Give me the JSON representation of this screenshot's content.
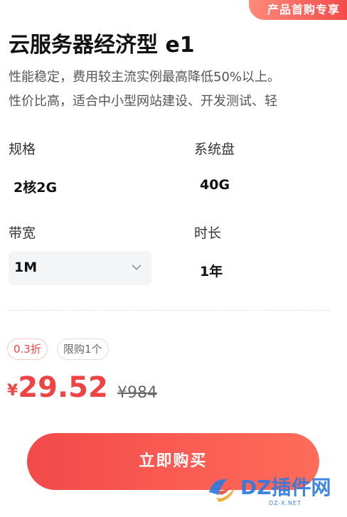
{
  "header": {
    "corner_tag": "产品首购专享",
    "title": "云服务器经济型 e1",
    "desc_lines": [
      "性能稳定，费用较主流实例最高降低50%以上。",
      "性价比高，适合中小型网站建设、开发测试、轻"
    ]
  },
  "specs": {
    "spec_label": "规格",
    "spec_value": "2核2G",
    "disk_label": "系统盘",
    "disk_value": "40G",
    "bandwidth_label": "带宽",
    "bandwidth_value": "1M",
    "duration_label": "时长",
    "duration_value": "1年"
  },
  "promo": {
    "discount_tag": "0.3折",
    "limit_tag": "限购1个"
  },
  "price": {
    "currency": "¥",
    "current": "29.52",
    "original": "¥984"
  },
  "action": {
    "buy_label": "立即购买"
  },
  "watermark": {
    "text": "DZ插件网",
    "sub": "DZ-X.NET"
  },
  "colors": {
    "accent": "#ef4444",
    "watermark": "#2d7be0"
  },
  "icons": {
    "select": "chevron-down-icon",
    "watermark": "dz-logo-icon"
  }
}
